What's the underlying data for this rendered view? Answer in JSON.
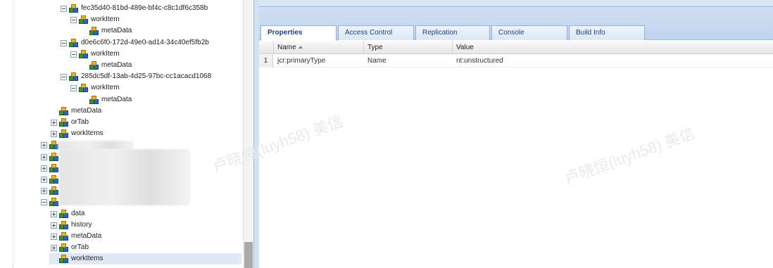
{
  "tree": {
    "nodes": [
      {
        "label": "fec35d40-81bd-489e-bf4c-c8c1df6c358b",
        "toggle": "minus"
      },
      {
        "label": "workItem",
        "toggle": "minus"
      },
      {
        "label": "metaData",
        "toggle": "none"
      },
      {
        "label": "d0e6c6f0-172d-49e0-ad14-34c40ef5fb2b",
        "toggle": "minus"
      },
      {
        "label": "workItem",
        "toggle": "minus"
      },
      {
        "label": "metaData",
        "toggle": "none"
      },
      {
        "label": "285dc5df-13ab-4d25-97bc-cc1acacd1068",
        "toggle": "minus"
      },
      {
        "label": "workItem",
        "toggle": "minus"
      },
      {
        "label": "metaData",
        "toggle": "none"
      },
      {
        "label": "metaData",
        "toggle": "none"
      },
      {
        "label": "orTab",
        "toggle": "plus"
      },
      {
        "label": "workItems",
        "toggle": "plus"
      },
      {
        "label": "",
        "toggle": "plus"
      },
      {
        "label": "",
        "toggle": "plus"
      },
      {
        "label": "",
        "toggle": "plus"
      },
      {
        "label": "",
        "toggle": "plus"
      },
      {
        "label": "",
        "toggle": "plus"
      },
      {
        "label": "",
        "toggle": "minus"
      },
      {
        "label": "data",
        "toggle": "plus"
      },
      {
        "label": "history",
        "toggle": "plus"
      },
      {
        "label": "metaData",
        "toggle": "plus"
      },
      {
        "label": "orTab",
        "toggle": "plus"
      },
      {
        "label": "workItems",
        "toggle": "none",
        "selected": true
      }
    ]
  },
  "tabs": [
    {
      "label": "Properties",
      "active": true
    },
    {
      "label": "Access Control"
    },
    {
      "label": "Replication"
    },
    {
      "label": "Console"
    },
    {
      "label": "Build Info"
    }
  ],
  "grid": {
    "columns": [
      "Name",
      "Type",
      "Value"
    ],
    "rows": [
      {
        "num": "1",
        "name": "jcr:primaryType",
        "type": "Name",
        "value": "nt:unstructured"
      }
    ]
  },
  "watermark": "卢晓恒(luyh58) 美信"
}
